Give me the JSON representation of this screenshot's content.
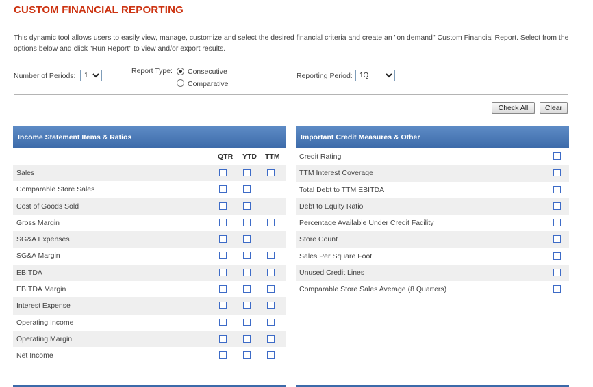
{
  "page": {
    "title": "CUSTOM FINANCIAL REPORTING",
    "description": "This dynamic tool allows users to easily view, manage, customize and select the desired financial criteria and create an \"on demand\" Custom Financial Report. Select from the options below and click \"Run Report\" to view and/or export results."
  },
  "controls": {
    "periods_label": "Number of Periods:",
    "periods_value": "1",
    "report_type_label": "Report Type:",
    "report_type_options": [
      "Consecutive",
      "Comparative"
    ],
    "report_type_selected": "Consecutive",
    "reporting_period_label": "Reporting Period:",
    "reporting_period_value": "1Q",
    "check_all_label": "Check All",
    "clear_label": "Clear"
  },
  "income_panel": {
    "title": "Income Statement Items & Ratios",
    "columns": [
      "QTR",
      "YTD",
      "TTM"
    ],
    "rows": [
      {
        "label": "Sales",
        "has": [
          true,
          true,
          true
        ]
      },
      {
        "label": "Comparable Store Sales",
        "has": [
          true,
          true,
          false
        ]
      },
      {
        "label": "Cost of Goods Sold",
        "has": [
          true,
          true,
          false
        ]
      },
      {
        "label": "Gross Margin",
        "has": [
          true,
          true,
          true
        ]
      },
      {
        "label": "SG&A Expenses",
        "has": [
          true,
          true,
          false
        ]
      },
      {
        "label": "SG&A Margin",
        "has": [
          true,
          true,
          true
        ]
      },
      {
        "label": "EBITDA",
        "has": [
          true,
          true,
          true
        ]
      },
      {
        "label": "EBITDA Margin",
        "has": [
          true,
          true,
          true
        ]
      },
      {
        "label": "Interest Expense",
        "has": [
          true,
          true,
          true
        ]
      },
      {
        "label": "Operating Income",
        "has": [
          true,
          true,
          true
        ]
      },
      {
        "label": "Operating Margin",
        "has": [
          true,
          true,
          true
        ]
      },
      {
        "label": "Net Income",
        "has": [
          true,
          true,
          true
        ]
      }
    ]
  },
  "credit_panel": {
    "title": "Important Credit Measures & Other",
    "rows": [
      "Credit Rating",
      "TTM Interest Coverage",
      "Total Debt to TTM EBITDA",
      "Debt to Equity Ratio",
      "Percentage Available Under Credit Facility",
      "Store Count",
      "Sales Per Square Foot",
      "Unused Credit Lines",
      "Comparable Store Sales Average (8 Quarters)"
    ]
  },
  "colors": {
    "title": "#cc3311",
    "panel_header": "#4a78b6",
    "checkbox_border": "#3d6bc7",
    "row_alt": "#efefef"
  }
}
